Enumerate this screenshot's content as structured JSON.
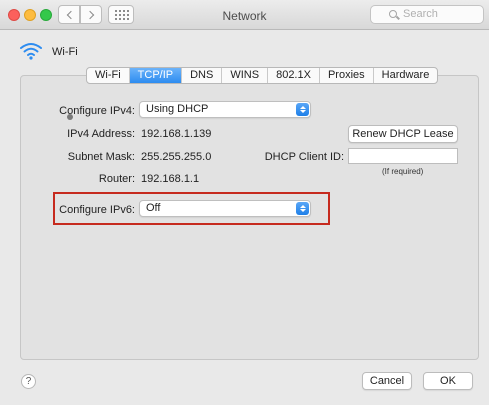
{
  "window": {
    "title": "Network",
    "search_placeholder": "Search"
  },
  "header": {
    "network_name": "Wi-Fi"
  },
  "tabs": [
    {
      "label": "Wi-Fi",
      "active": false
    },
    {
      "label": "TCP/IP",
      "active": true
    },
    {
      "label": "DNS",
      "active": false
    },
    {
      "label": "WINS",
      "active": false
    },
    {
      "label": "802.1X",
      "active": false
    },
    {
      "label": "Proxies",
      "active": false
    },
    {
      "label": "Hardware",
      "active": false
    }
  ],
  "ipv4": {
    "configure_label": "Configure IPv4:",
    "configure_value": "Using DHCP",
    "address_label": "IPv4 Address:",
    "address_value": "192.168.1.139",
    "subnet_label": "Subnet Mask:",
    "subnet_value": "255.255.255.0",
    "router_label": "Router:",
    "router_value": "192.168.1.1"
  },
  "dhcp": {
    "renew_label": "Renew DHCP Lease",
    "client_id_label": "DHCP Client ID:",
    "client_id_value": "",
    "client_id_hint": "(If required)"
  },
  "ipv6": {
    "configure_label": "Configure IPv6:",
    "configure_value": "Off"
  },
  "footer": {
    "help": "?",
    "cancel_label": "Cancel",
    "ok_label": "OK"
  },
  "colors": {
    "accent": "#2d8cf0",
    "highlight_box": "#c62a1e"
  }
}
